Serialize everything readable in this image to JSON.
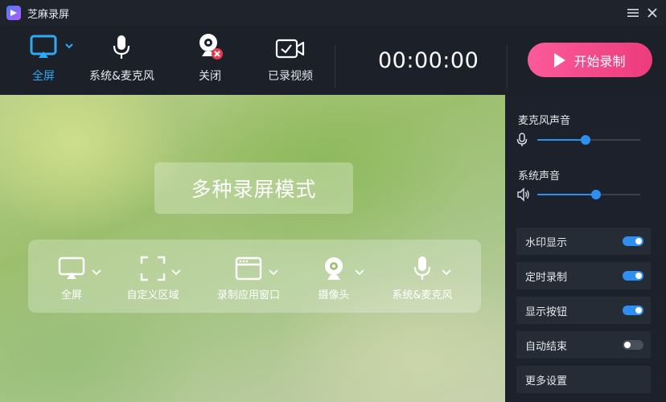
{
  "app": {
    "title": "芝麻录屏",
    "menu_icon": "hamburger-icon",
    "close_icon": "close-icon"
  },
  "toolbar": {
    "fullscreen_label": "全屏",
    "audio_label": "系统&麦克风",
    "camera_label": "关闭",
    "recordings_label": "已录视频",
    "timer": "00:00:00",
    "start_label": "开始录制",
    "accent": "#2ea9f5",
    "start_color": "#f24a8a"
  },
  "preview": {
    "title": "多种录屏模式",
    "modes": [
      {
        "label": "全屏",
        "icon": "monitor-icon"
      },
      {
        "label": "自定义区域",
        "icon": "region-select-icon"
      },
      {
        "label": "录制应用窗口",
        "icon": "app-window-icon"
      },
      {
        "label": "摄像头",
        "icon": "webcam-icon"
      },
      {
        "label": "系统&麦克风",
        "icon": "microphone-icon"
      }
    ]
  },
  "panel": {
    "mic_title": "麦克风声音",
    "mic_volume": 0.47,
    "system_title": "系统声音",
    "system_volume": 0.57,
    "options": [
      {
        "label": "水印显示",
        "on": true
      },
      {
        "label": "定时录制",
        "on": true
      },
      {
        "label": "显示按钮",
        "on": true
      },
      {
        "label": "自动结束",
        "on": false
      },
      {
        "label": "更多设置"
      }
    ]
  }
}
